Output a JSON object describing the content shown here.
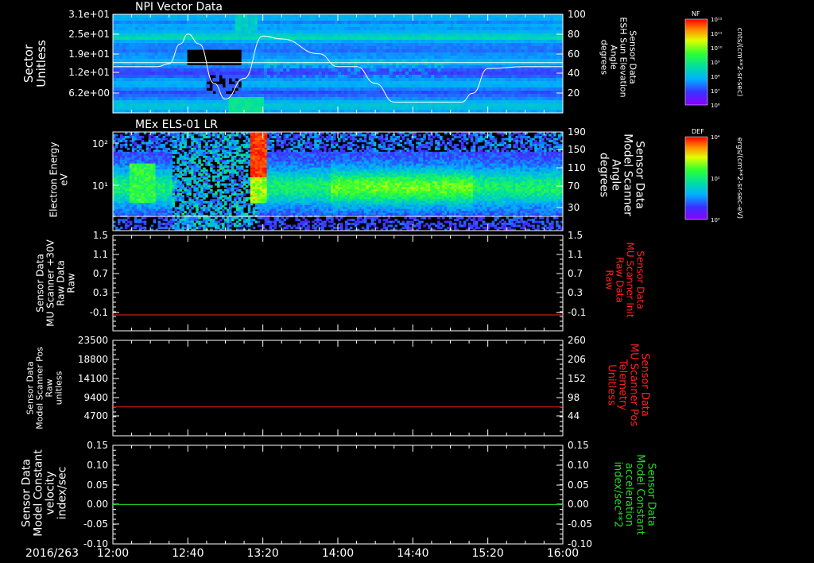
{
  "colors": {
    "background": "#000000",
    "axis": "#ffffff",
    "red_trace": "#ff2020",
    "green_trace": "#22dd22",
    "right_label_red": "#ff2020",
    "right_label_green": "#22dd22"
  },
  "footer": {
    "date": "2016/263",
    "time_ticks": [
      "12:00",
      "12:40",
      "13:20",
      "14:00",
      "14:40",
      "15:20",
      "16:00"
    ]
  },
  "colorbars": [
    {
      "label": "NF",
      "units": "cnts/(cm**2-sr-sec)",
      "tick_labels": [
        "10¹²",
        "10¹¹",
        "10¹⁰",
        "10⁹",
        "10⁸",
        "10⁷",
        "10⁶"
      ]
    },
    {
      "label": "DEF",
      "units": "ergs/(cm**2-sr-sec-eV)",
      "tick_labels": [
        "10⁴",
        "10²",
        "10⁰"
      ]
    }
  ],
  "chart_data": [
    {
      "type": "heatmap",
      "title": "NPI Vector Data",
      "ylabel": [
        "Sector",
        "Unitless"
      ],
      "y_tick_labels": [
        "3.1e+01",
        "2.5e+01",
        "1.9e+01",
        "1.2e+01",
        "6.2e+00"
      ],
      "y_ticks": [
        31,
        25,
        19,
        12,
        6.2
      ],
      "ylim": [
        0,
        31
      ],
      "right_ylabel": [
        "Sensor Data",
        "ESH Sun Elevation",
        "Angle",
        "degrees"
      ],
      "right_y_tick_labels": [
        "100",
        "80",
        "60",
        "40",
        "20"
      ],
      "right_ylim": [
        0,
        100
      ],
      "overlay_series": {
        "name": "ESH Sun Elevation Angle",
        "x": [
          "12:00",
          "12:24",
          "12:30",
          "12:36",
          "12:40",
          "12:46",
          "12:54",
          "13:00",
          "13:10",
          "13:20",
          "13:30",
          "13:50",
          "14:00",
          "14:10",
          "14:20",
          "14:30",
          "14:40",
          "14:50",
          "15:00",
          "15:06",
          "15:12",
          "15:20",
          "15:40",
          "16:00"
        ],
        "values": [
          47,
          47,
          50,
          70,
          80,
          70,
          30,
          14,
          35,
          78,
          75,
          60,
          47,
          47,
          30,
          11,
          11,
          11,
          11,
          11,
          20,
          45,
          47,
          47
        ]
      },
      "colorbar": "NF"
    },
    {
      "type": "heatmap",
      "title": "MEx ELS-01 LR",
      "ylabel": [
        "Electron Energy",
        "eV"
      ],
      "y_tick_labels": [
        "10²",
        "10¹"
      ],
      "y_scale": "log",
      "right_ylabel": [
        "Sensor Data",
        "Model Scanner",
        "Angle",
        "degrees"
      ],
      "right_y_tick_labels": [
        "190",
        "150",
        "110",
        "70",
        "30"
      ],
      "right_ylim": [
        0,
        190
      ],
      "colorbar": "DEF"
    },
    {
      "type": "line",
      "ylabel": [
        "Sensor Data",
        "MU Scanner +30V",
        "Raw Data",
        "Raw"
      ],
      "y_tick_labels": [
        "1.5",
        "1.1",
        "0.7",
        "0.3",
        "-0.1"
      ],
      "ylim": [
        -0.3,
        1.5
      ],
      "right_ylabel": [
        "Sensor Data",
        "MU Scanner Init",
        "Raw Data",
        "Raw"
      ],
      "right_y_tick_labels": [
        "1.5",
        "1.1",
        "0.7",
        "0.3",
        "-0.1"
      ],
      "right_ylim": [
        -0.3,
        1.5
      ],
      "series": [
        {
          "values_constant": 0.0,
          "color": "red"
        }
      ]
    },
    {
      "type": "line",
      "ylabel": [
        "Sensor Data",
        "Model Scanner Pos",
        "Raw",
        "unitless"
      ],
      "y_tick_labels": [
        "23500",
        "18800",
        "14100",
        "9400",
        "4700"
      ],
      "ylim": [
        0,
        23500
      ],
      "right_ylabel": [
        "Sensor Data",
        "MU Scanner Pos",
        "Telemetry",
        "Unitless"
      ],
      "right_y_tick_labels": [
        "260",
        "206",
        "152",
        "98",
        "44"
      ],
      "right_ylim": [
        0,
        260
      ],
      "series": [
        {
          "values_constant": 7100,
          "color": "red"
        }
      ]
    },
    {
      "type": "line",
      "ylabel": [
        "Sensor Data",
        "Model Constant",
        "velocity",
        "index/sec"
      ],
      "y_tick_labels": [
        "0.15",
        "0.10",
        "0.05",
        "0.00",
        "-0.05",
        "-0.10"
      ],
      "ylim": [
        -0.1,
        0.15
      ],
      "right_ylabel": [
        "Sensor Data",
        "Model Constant",
        "acceleration",
        "index/sec**2"
      ],
      "right_y_tick_labels": [
        "0.15",
        "0.10",
        "0.05",
        "0.00",
        "-0.05",
        "-0.10"
      ],
      "right_ylim": [
        -0.1,
        0.15
      ],
      "series": [
        {
          "values_constant": 0.0,
          "color": "green"
        }
      ]
    }
  ]
}
